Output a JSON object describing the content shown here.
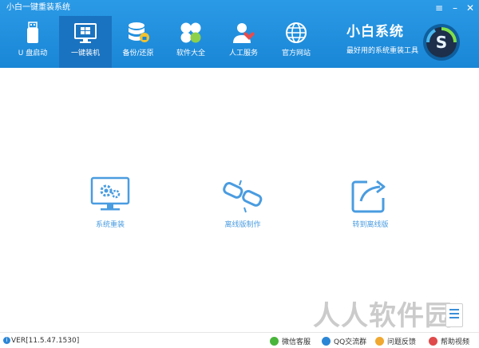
{
  "window": {
    "title": "小白一键重装系统",
    "menu_glyph": "≡",
    "minimize_glyph": "–",
    "close_glyph": "✕"
  },
  "nav": {
    "items": [
      {
        "label": "U 盘启动",
        "icon": "usb-drive-icon"
      },
      {
        "label": "一键装机",
        "icon": "monitor-windows-icon",
        "active": true
      },
      {
        "label": "备份/还原",
        "icon": "database-backup-icon"
      },
      {
        "label": "软件大全",
        "icon": "software-clover-icon"
      },
      {
        "label": "人工服务",
        "icon": "support-person-icon"
      },
      {
        "label": "官方网站",
        "icon": "globe-icon"
      }
    ]
  },
  "brand": {
    "name": "小白系统",
    "slogan": "最好用的系统重装工具",
    "logo_icon": "xiaobai-logo-icon"
  },
  "actions": [
    {
      "label": "系统重装",
      "icon": "monitor-gears-icon"
    },
    {
      "label": "离线版制作",
      "icon": "broken-link-icon"
    },
    {
      "label": "转到离线版",
      "icon": "share-arrow-icon"
    }
  ],
  "watermark": "人人软件园",
  "footer": {
    "version": "VER[11.5.47.1530]",
    "links": [
      {
        "label": "微信客服",
        "icon": "wechat-icon"
      },
      {
        "label": "QQ交流群",
        "icon": "qq-icon"
      },
      {
        "label": "问题反馈",
        "icon": "feedback-icon"
      },
      {
        "label": "帮助视频",
        "icon": "help-video-icon"
      }
    ]
  },
  "colors": {
    "header_blue": "#1a86d6",
    "active_tab": "#1a73c0",
    "action_blue": "#4a9ce0"
  }
}
